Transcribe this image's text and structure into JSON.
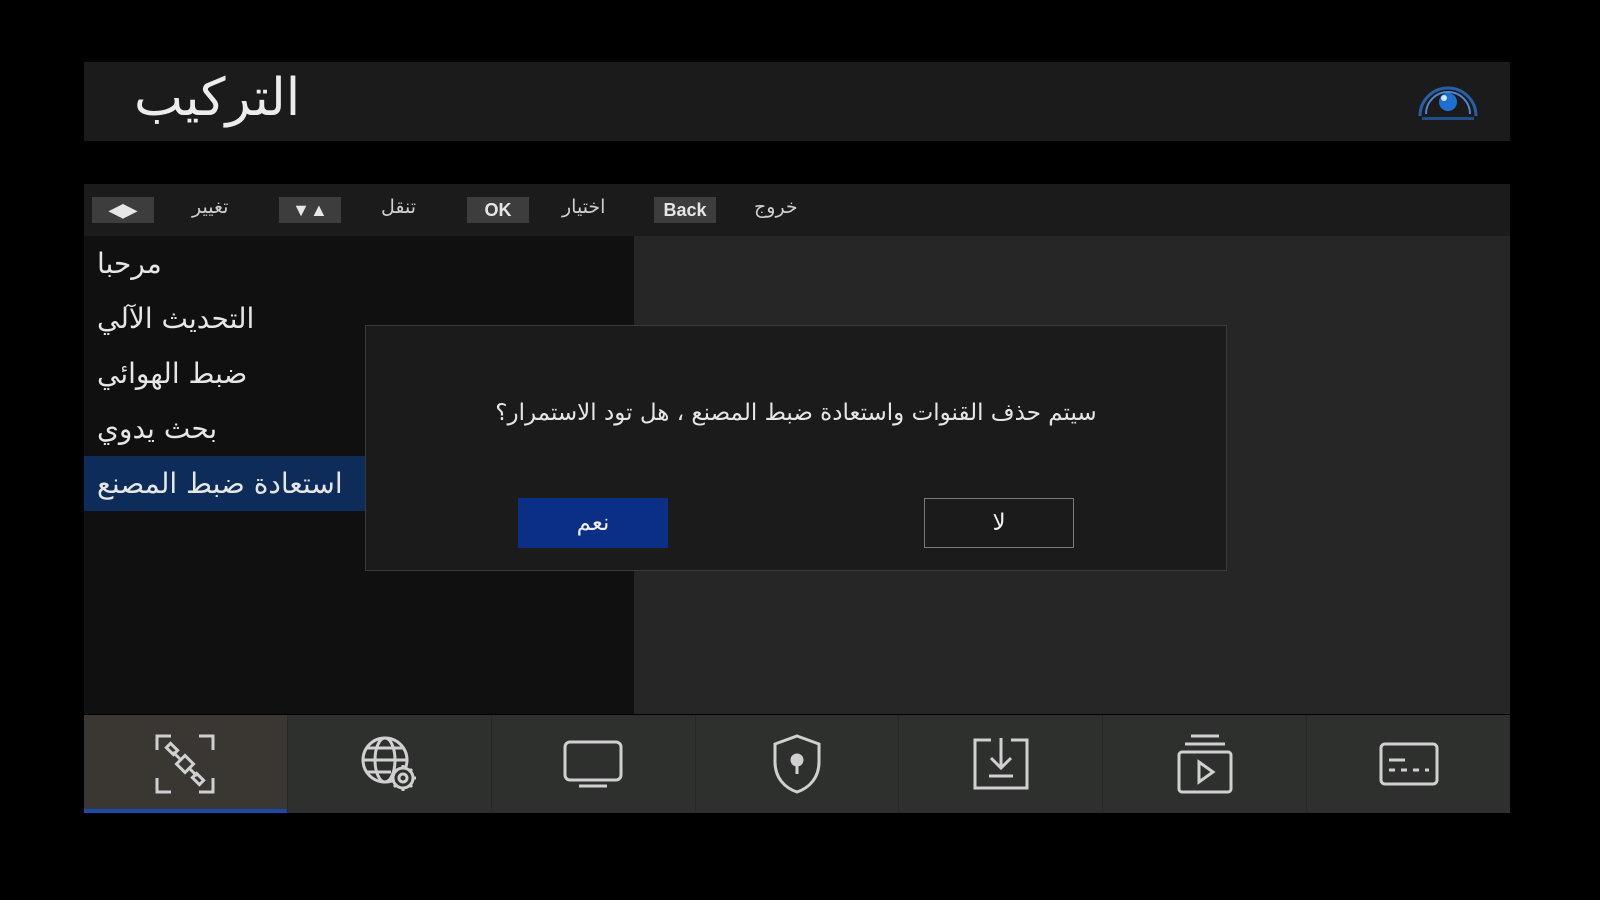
{
  "header": {
    "title": "التركيب",
    "logo_icon": "satellite-dish-logo"
  },
  "helpbar": {
    "keys": [
      {
        "key": "◀▶",
        "label": "تغيير"
      },
      {
        "key": "▼▲",
        "label": "تنقل"
      },
      {
        "key": "OK",
        "label": "اختيار"
      },
      {
        "key": "Back",
        "label": "خروج"
      }
    ]
  },
  "menu": {
    "items": [
      {
        "label": "مرحبا"
      },
      {
        "label": "التحديث الآلي"
      },
      {
        "label": "ضبط الهوائي"
      },
      {
        "label": "بحث يدوي"
      },
      {
        "label": "استعادة ضبط المصنع"
      }
    ],
    "selected_index": 4
  },
  "dialog": {
    "message": "سيتم حذف القنوات واستعادة ضبط المصنع ، هل تود الاستمرار؟",
    "yes_label": "نعم",
    "no_label": "لا"
  },
  "bottom_nav": {
    "tabs": [
      {
        "icon": "satellite-icon",
        "active": true
      },
      {
        "icon": "globe-settings-icon",
        "active": false
      },
      {
        "icon": "monitor-icon",
        "active": false
      },
      {
        "icon": "shield-lock-icon",
        "active": false
      },
      {
        "icon": "download-icon",
        "active": false
      },
      {
        "icon": "media-library-icon",
        "active": false
      },
      {
        "icon": "subtitles-icon",
        "active": false
      }
    ]
  },
  "colors": {
    "selection": "#0d2c5a",
    "yes_button": "#0c2f86",
    "active_tab_underline": "#1d4aa8"
  }
}
